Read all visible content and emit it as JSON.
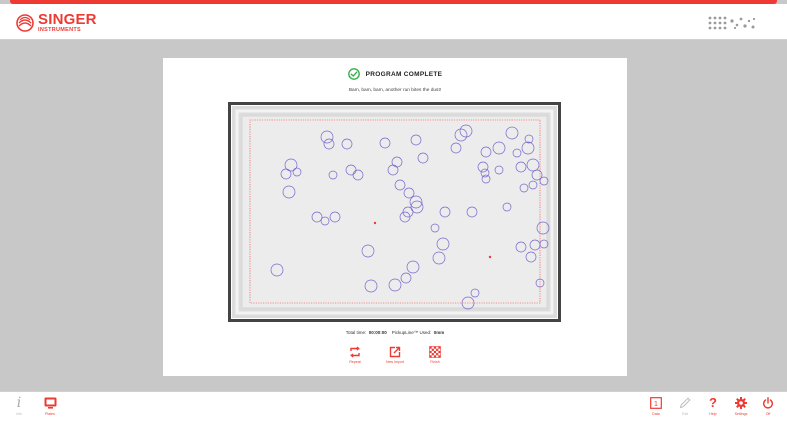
{
  "brand": {
    "name": "SINGER",
    "sub": "INSTRUMENTS"
  },
  "status": {
    "title": "PROGRAM COMPLETE",
    "message": "Bam, bam, bam, another run bites the dust!"
  },
  "stats": {
    "time_label": "Total time:",
    "time_value": "00:00:00",
    "pins_label": "PickupLine™ Used:",
    "pins_value": "0mm"
  },
  "actions": [
    {
      "label": "Repeat",
      "icon": "repeat-icon"
    },
    {
      "label": "New Import",
      "icon": "new-import-icon"
    },
    {
      "label": "Finish",
      "icon": "finish-flag-icon"
    }
  ],
  "footer": {
    "info": {
      "label": "Info",
      "icon": "info-icon"
    },
    "plates": {
      "label": "Plates",
      "icon": "plates-icon"
    },
    "right": [
      {
        "label": "Data",
        "icon": "data-icon"
      },
      {
        "label": "Edit",
        "icon": "edit-icon",
        "disabled": true
      },
      {
        "label": "Help",
        "icon": "help-icon"
      },
      {
        "label": "Settings",
        "icon": "settings-icon"
      },
      {
        "label": "Off",
        "icon": "power-icon"
      }
    ]
  },
  "colors": {
    "accent": "#ee3a33",
    "success": "#36b34a",
    "colony": "#7766cc",
    "bg": "#c8c8c8"
  },
  "plate": {
    "colonies": [
      [
        77,
        17,
        6
      ],
      [
        79,
        24,
        5
      ],
      [
        97,
        24,
        5
      ],
      [
        135,
        23,
        5
      ],
      [
        166,
        20,
        5
      ],
      [
        211,
        15,
        6
      ],
      [
        216,
        11,
        6
      ],
      [
        262,
        13,
        6
      ],
      [
        279,
        19,
        4
      ],
      [
        278,
        28,
        6
      ],
      [
        249,
        28,
        6
      ],
      [
        236,
        32,
        5
      ],
      [
        206,
        28,
        5
      ],
      [
        267,
        33,
        4
      ],
      [
        173,
        38,
        5
      ],
      [
        147,
        42,
        5
      ],
      [
        143,
        50,
        5
      ],
      [
        101,
        50,
        5
      ],
      [
        108,
        55,
        5
      ],
      [
        83,
        55,
        4
      ],
      [
        41,
        45,
        6
      ],
      [
        47,
        52,
        4
      ],
      [
        36,
        54,
        5
      ],
      [
        39,
        72,
        6
      ],
      [
        233,
        47,
        5
      ],
      [
        235,
        53,
        4
      ],
      [
        236,
        59,
        4
      ],
      [
        249,
        50,
        4
      ],
      [
        271,
        47,
        5
      ],
      [
        283,
        45,
        6
      ],
      [
        287,
        55,
        5
      ],
      [
        283,
        65,
        4
      ],
      [
        274,
        68,
        4
      ],
      [
        294,
        61,
        4
      ],
      [
        150,
        65,
        5
      ],
      [
        159,
        73,
        5
      ],
      [
        166,
        82,
        6
      ],
      [
        167,
        87,
        6
      ],
      [
        158,
        92,
        5
      ],
      [
        155,
        97,
        5
      ],
      [
        67,
        97,
        5
      ],
      [
        75,
        101,
        4
      ],
      [
        85,
        97,
        5
      ],
      [
        195,
        92,
        5
      ],
      [
        222,
        92,
        5
      ],
      [
        257,
        87,
        4
      ],
      [
        185,
        108,
        4
      ],
      [
        293,
        108,
        6
      ],
      [
        285,
        125,
        5
      ],
      [
        294,
        124,
        4
      ],
      [
        271,
        127,
        5
      ],
      [
        281,
        137,
        5
      ],
      [
        193,
        124,
        6
      ],
      [
        189,
        138,
        6
      ],
      [
        118,
        131,
        6
      ],
      [
        163,
        147,
        6
      ],
      [
        156,
        158,
        5
      ],
      [
        145,
        165,
        6
      ],
      [
        121,
        166,
        6
      ],
      [
        27,
        150,
        6
      ],
      [
        225,
        173,
        4
      ],
      [
        218,
        183,
        6
      ],
      [
        290,
        163,
        4
      ]
    ],
    "markers": [
      [
        125,
        103
      ],
      [
        240,
        137
      ]
    ]
  }
}
